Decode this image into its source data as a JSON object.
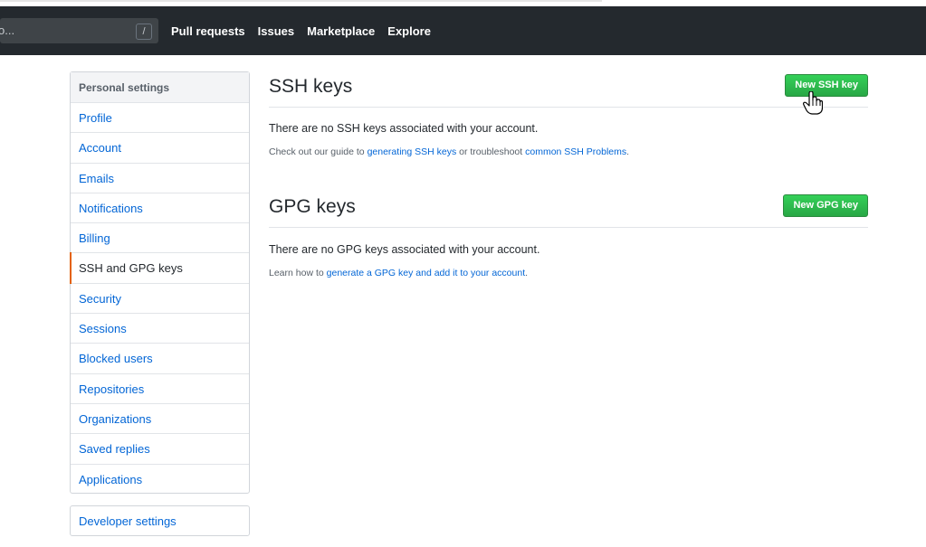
{
  "header": {
    "search_text": "o...",
    "search_shortcut": "/",
    "nav": [
      "Pull requests",
      "Issues",
      "Marketplace",
      "Explore"
    ]
  },
  "sidebar": {
    "heading": "Personal settings",
    "items": [
      {
        "label": "Profile"
      },
      {
        "label": "Account"
      },
      {
        "label": "Emails"
      },
      {
        "label": "Notifications"
      },
      {
        "label": "Billing"
      },
      {
        "label": "SSH and GPG keys",
        "active": true
      },
      {
        "label": "Security"
      },
      {
        "label": "Sessions"
      },
      {
        "label": "Blocked users"
      },
      {
        "label": "Repositories"
      },
      {
        "label": "Organizations"
      },
      {
        "label": "Saved replies"
      },
      {
        "label": "Applications"
      }
    ],
    "developer_settings": "Developer settings"
  },
  "ssh": {
    "title": "SSH keys",
    "button": "New SSH key",
    "empty_message": "There are no SSH keys associated with your account.",
    "note_prefix": "Check out our guide to ",
    "note_link1": "generating SSH keys",
    "note_middle": " or troubleshoot ",
    "note_link2": "common SSH Problems",
    "note_suffix": "."
  },
  "gpg": {
    "title": "GPG keys",
    "button": "New GPG key",
    "empty_message": "There are no GPG keys associated with your account.",
    "note_prefix": "Learn how to ",
    "note_link": "generate a GPG key and add it to your account",
    "note_suffix": "."
  },
  "colors": {
    "header_bg": "#24292e",
    "link": "#0366d6",
    "button_green": "#28a745",
    "active_marker": "#e36209"
  },
  "icons": {
    "cursor": "hand-pointer-icon"
  }
}
